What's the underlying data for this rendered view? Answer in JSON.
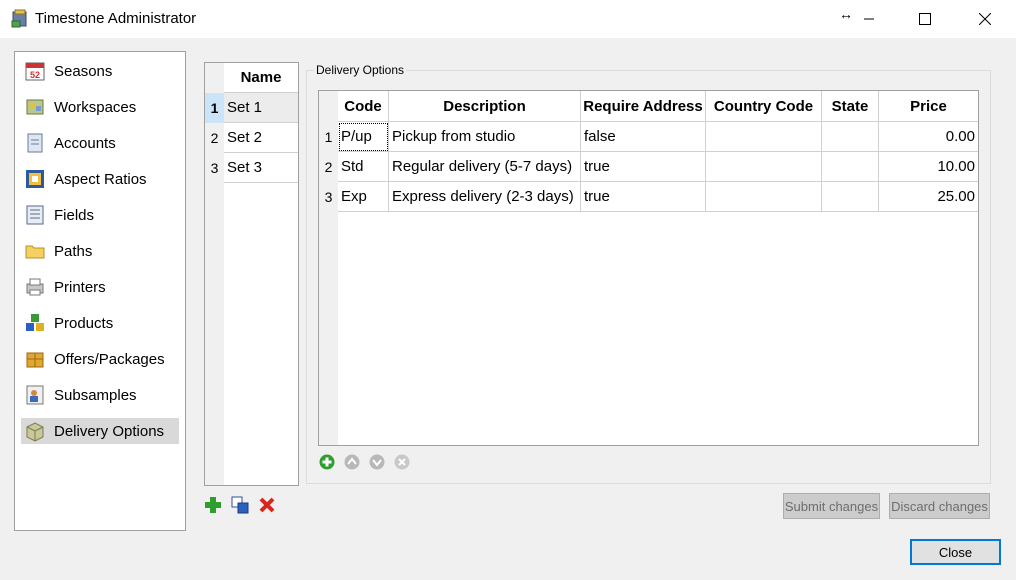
{
  "window": {
    "title": "Timestone Administrator",
    "controls": {
      "arrow": "↔",
      "minimize": "—",
      "maximize": "☐",
      "close": "✕"
    }
  },
  "nav": {
    "items": [
      {
        "label": "Seasons",
        "icon": "calendar-icon",
        "selected": false
      },
      {
        "label": "Workspaces",
        "icon": "workspaces-icon",
        "selected": false
      },
      {
        "label": "Accounts",
        "icon": "accounts-icon",
        "selected": false
      },
      {
        "label": "Aspect Ratios",
        "icon": "aspect-ratio-icon",
        "selected": false
      },
      {
        "label": "Fields",
        "icon": "fields-icon",
        "selected": false
      },
      {
        "label": "Paths",
        "icon": "folder-icon",
        "selected": false
      },
      {
        "label": "Printers",
        "icon": "printer-icon",
        "selected": false
      },
      {
        "label": "Products",
        "icon": "products-icon",
        "selected": false
      },
      {
        "label": "Offers/Packages",
        "icon": "package-icon",
        "selected": false
      },
      {
        "label": "Subsamples",
        "icon": "subsamples-icon",
        "selected": false
      },
      {
        "label": "Delivery Options",
        "icon": "delivery-box-icon",
        "selected": true
      }
    ]
  },
  "sets": {
    "header": "Name",
    "rows": [
      {
        "num": "1",
        "name": "Set 1",
        "selected": true
      },
      {
        "num": "2",
        "name": "Set 2",
        "selected": false
      },
      {
        "num": "3",
        "name": "Set 3",
        "selected": false
      }
    ]
  },
  "delivery": {
    "group_label": "Delivery Options",
    "columns": [
      "Code",
      "Description",
      "Require Address",
      "Country Code",
      "State",
      "Price"
    ],
    "rows": [
      {
        "num": "1",
        "code": "P/up",
        "description": "Pickup from studio",
        "require_address": "false",
        "country_code": "",
        "state": "",
        "price": "0.00"
      },
      {
        "num": "2",
        "code": "Std",
        "description": "Regular delivery (5-7 days)",
        "require_address": "true",
        "country_code": "",
        "state": "",
        "price": "10.00"
      },
      {
        "num": "3",
        "code": "Exp",
        "description": "Express delivery (2-3 days)",
        "require_address": "true",
        "country_code": "",
        "state": "",
        "price": "25.00"
      }
    ]
  },
  "buttons": {
    "submit": "Submit changes",
    "discard": "Discard changes",
    "close": "Close"
  },
  "colors": {
    "accent": "#0078d7",
    "add_green": "#2e9e2e",
    "delete_red": "#d9261c"
  }
}
